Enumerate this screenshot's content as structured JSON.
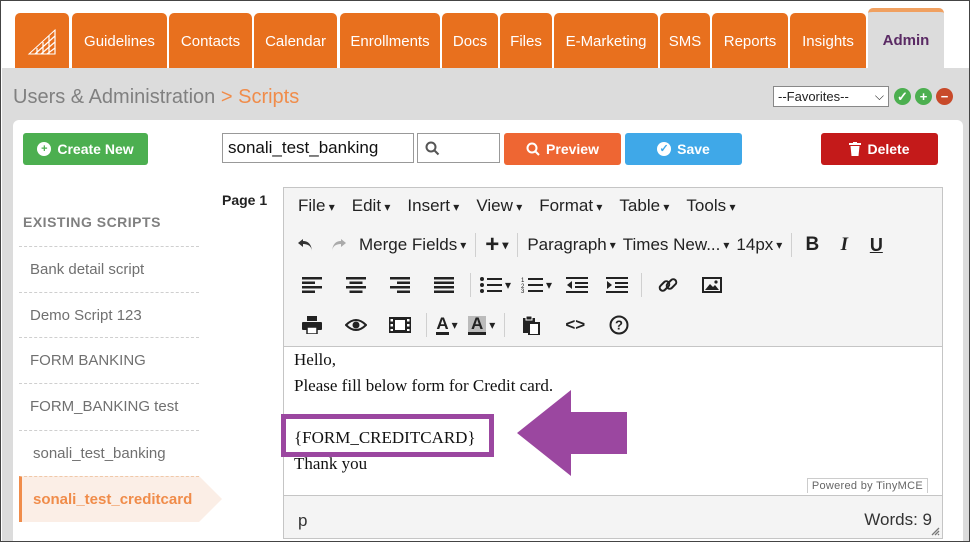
{
  "nav": {
    "tabs": [
      "Guidelines",
      "Contacts",
      "Calendar",
      "Enrollments",
      "Docs",
      "Files",
      "E-Marketing",
      "SMS",
      "Reports",
      "Insights",
      "Admin"
    ],
    "active_tab": "Admin"
  },
  "breadcrumb": {
    "parent": "Users & Administration",
    "separator": ">",
    "current": "Scripts"
  },
  "favorites": {
    "selected": "--Favorites--"
  },
  "toolbar": {
    "create_label": "Create New",
    "name_value": "sonali_test_banking",
    "preview_label": "Preview",
    "save_label": "Save",
    "delete_label": "Delete"
  },
  "sidebar": {
    "heading": "EXISTING SCRIPTS",
    "items": [
      "Bank detail script",
      "Demo Script 123",
      "FORM BANKING",
      "FORM_BANKING test",
      "sonali_test_banking",
      "sonali_test_creditcard"
    ],
    "active_item": "sonali_test_creditcard"
  },
  "page_label": "Page 1",
  "editor": {
    "menu": [
      "File",
      "Edit",
      "Insert",
      "View",
      "Format",
      "Table",
      "Tools"
    ],
    "merge_fields": "Merge Fields",
    "block_format": "Paragraph",
    "font_family": "Times New...",
    "font_size": "14px",
    "content": {
      "line1": "Hello,",
      "line2": "Please fill below form for Credit card.",
      "line3": "{FORM_CREDITCARD}",
      "line4": "Thank you"
    },
    "branding": "Powered by TinyMCE",
    "status_path": "p",
    "word_count": "Words: 9"
  },
  "colors": {
    "orange": "#e8701e",
    "green": "#4caf50",
    "preview": "#ee6633",
    "save": "#3fa8e8",
    "delete": "#c41a1a",
    "highlight": "#9b47a0"
  }
}
